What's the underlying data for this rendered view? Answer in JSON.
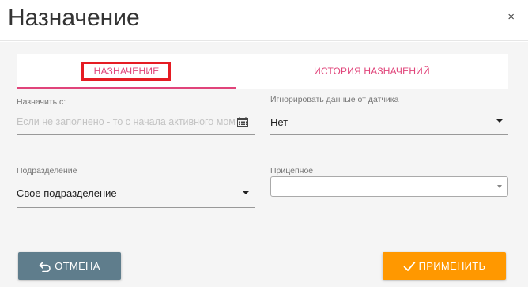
{
  "dialog": {
    "title": "Назначение",
    "close_icon": "×"
  },
  "tabs": [
    {
      "label": "НАЗНАЧЕНИЕ",
      "active": true
    },
    {
      "label": "ИСТОРИЯ НАЗНАЧЕНИЙ",
      "active": false
    }
  ],
  "form": {
    "assign_from": {
      "label": "Назначить с:",
      "placeholder": "Если не заполнено - то с начала активного момента",
      "icon": "calendar-icon"
    },
    "ignore_sensor": {
      "label": "Игнорировать данные от датчика",
      "value": "Нет"
    },
    "department": {
      "label": "Подразделение",
      "value": "Свое подразделение"
    },
    "trailer": {
      "label": "Прицепное",
      "value": ""
    }
  },
  "buttons": {
    "cancel": {
      "label": "ОТМЕНА",
      "icon": "undo-arrow-icon",
      "color": "#5f7d8c"
    },
    "apply": {
      "label": "ПРИМЕНИТЬ",
      "icon": "checkmark-icon",
      "color": "#ff9800"
    }
  },
  "colors": {
    "accent": "#e0447a",
    "highlight_box": "#e51c23",
    "background": "#f5f5f5"
  }
}
